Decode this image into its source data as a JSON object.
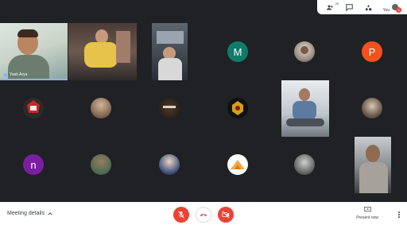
{
  "topbar": {
    "participants_count": "20",
    "you_label": "You",
    "notification_count": "5",
    "icons": [
      "people-icon",
      "chat-icon",
      "activities-icon",
      "avatar"
    ]
  },
  "tiles": {
    "yash": {
      "name": "Yash Arya"
    },
    "m_initial": {
      "letter": "M",
      "color": "#0f7c6a"
    },
    "p_initial": {
      "letter": "P",
      "color": "#f4511e"
    },
    "n_initial": {
      "letter": "n",
      "color": "#7b1fa2"
    }
  },
  "bottombar": {
    "meeting_details_label": "Meeting details",
    "present_now_label": "Present now",
    "mic_state": "off",
    "camera_state": "off"
  },
  "colors": {
    "background": "#202124",
    "danger": "#ea4335",
    "accent": "#8ab4f8"
  }
}
